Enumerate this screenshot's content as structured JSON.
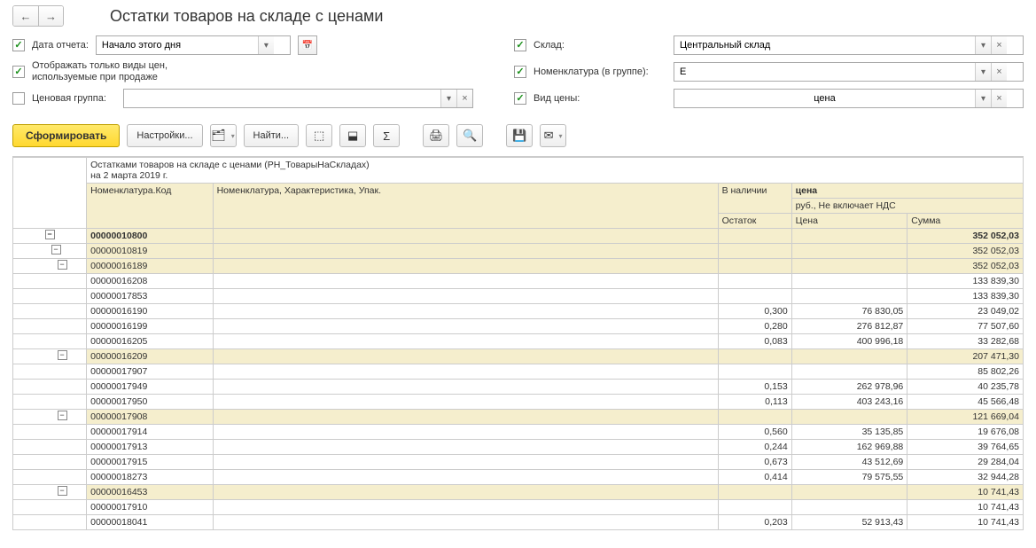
{
  "title": "Остатки товаров на складе с ценами",
  "filters": {
    "report_date_label": "Дата отчета:",
    "report_date_value": "Начало этого дня",
    "only_sale_prices_label": "Отображать только виды цен, используемые при продаже",
    "price_group_label": "Ценовая группа:",
    "price_group_value": "",
    "warehouse_label": "Склад:",
    "warehouse_value": "Центральный склад",
    "nom_label": "Номенклатура (в группе):",
    "nom_value": "Е",
    "price_type_label": "Вид цены:",
    "price_type_value": "цена"
  },
  "toolbar": {
    "generate": "Сформировать",
    "settings": "Настройки...",
    "find": "Найти..."
  },
  "report": {
    "title": "Остатками товаров на складе с ценами (РН_ТоварыНаСкладах)",
    "date": "на 2 марта 2019 г.",
    "cols": {
      "code": "Номенклатура.Код",
      "name": "Номенклатура, Характеристика, Упак.",
      "stock_head": "В наличии",
      "stock_sub": "Остаток",
      "price_head": "цена",
      "price_sub": "руб., Не включает НДС",
      "price": "Цена",
      "sum": "Сумма"
    },
    "rows": [
      {
        "lvl": 0,
        "code": "00000010800",
        "name": "",
        "stock": "",
        "price": "",
        "sum": "352 052,03"
      },
      {
        "lvl": 1,
        "code": "00000010819",
        "name": "",
        "stock": "",
        "price": "",
        "sum": "352 052,03"
      },
      {
        "lvl": 2,
        "code": "00000016189",
        "name": "",
        "stock": "",
        "price": "",
        "sum": "352 052,03"
      },
      {
        "lvl": 3,
        "code": "00000016208",
        "name": "",
        "stock": "",
        "price": "",
        "sum": "133 839,30"
      },
      {
        "lvl": 3,
        "code": "00000017853",
        "name": "",
        "stock": "",
        "price": "",
        "sum": "133 839,30"
      },
      {
        "lvl": 3,
        "code": "00000016190",
        "name": "",
        "stock": "0,300",
        "price": "76 830,05",
        "sum": "23 049,02"
      },
      {
        "lvl": 3,
        "code": "00000016199",
        "name": "",
        "stock": "0,280",
        "price": "276 812,87",
        "sum": "77 507,60"
      },
      {
        "lvl": 3,
        "code": "00000016205",
        "name": "",
        "stock": "0,083",
        "price": "400 996,18",
        "sum": "33 282,68"
      },
      {
        "lvl": 2,
        "code": "00000016209",
        "name": "",
        "stock": "",
        "price": "",
        "sum": "207 471,30"
      },
      {
        "lvl": 3,
        "code": "00000017907",
        "name": "",
        "stock": "",
        "price": "",
        "sum": "85 802,26"
      },
      {
        "lvl": 3,
        "code": "00000017949",
        "name": "",
        "stock": "0,153",
        "price": "262 978,96",
        "sum": "40 235,78"
      },
      {
        "lvl": 3,
        "code": "00000017950",
        "name": "",
        "stock": "0,113",
        "price": "403 243,16",
        "sum": "45 566,48"
      },
      {
        "lvl": 2,
        "code": "00000017908",
        "name": "",
        "stock": "",
        "price": "",
        "sum": "121 669,04"
      },
      {
        "lvl": 3,
        "code": "00000017914",
        "name": "",
        "stock": "0,560",
        "price": "35 135,85",
        "sum": "19 676,08"
      },
      {
        "lvl": 3,
        "code": "00000017913",
        "name": "",
        "stock": "0,244",
        "price": "162 969,88",
        "sum": "39 764,65"
      },
      {
        "lvl": 3,
        "code": "00000017915",
        "name": "",
        "stock": "0,673",
        "price": "43 512,69",
        "sum": "29 284,04"
      },
      {
        "lvl": 3,
        "code": "00000018273",
        "name": "",
        "stock": "0,414",
        "price": "79 575,55",
        "sum": "32 944,28"
      },
      {
        "lvl": 2,
        "code": "00000016453",
        "name": "",
        "stock": "",
        "price": "",
        "sum": "10 741,43"
      },
      {
        "lvl": 3,
        "code": "00000017910",
        "name": "",
        "stock": "",
        "price": "",
        "sum": "10 741,43"
      },
      {
        "lvl": 3,
        "code": "00000018041",
        "name": "",
        "stock": "0,203",
        "price": "52 913,43",
        "sum": "10 741,43"
      }
    ]
  }
}
